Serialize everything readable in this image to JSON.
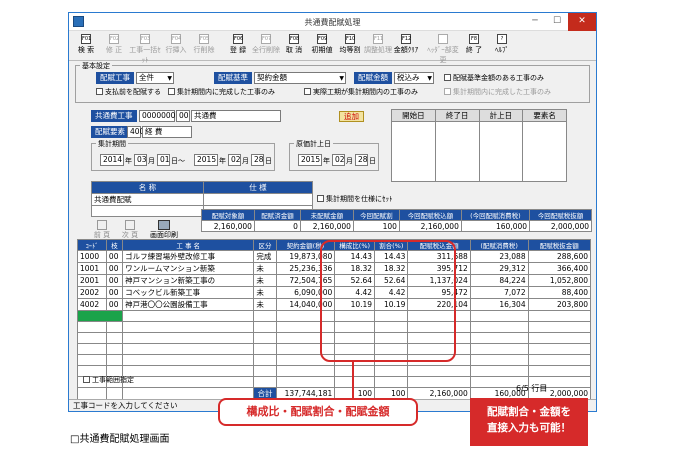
{
  "window": {
    "title": "共通費配賦処理"
  },
  "toolbar": [
    {
      "key": "F01",
      "label": "検 索",
      "enabled": true
    },
    {
      "key": "F02",
      "label": "修 正",
      "enabled": false
    },
    {
      "key": "F03",
      "label": "工事一括ｾｯﾄ",
      "enabled": false
    },
    {
      "key": "F04",
      "label": "行挿入",
      "enabled": false
    },
    {
      "key": "F05",
      "label": "行削除",
      "enabled": false
    },
    {
      "key": "F06",
      "label": "登 録",
      "enabled": true
    },
    {
      "key": "F07",
      "label": "全行削除",
      "enabled": false
    },
    {
      "key": "F08",
      "label": "取 消",
      "enabled": true
    },
    {
      "key": "F09",
      "label": "初期値",
      "enabled": true
    },
    {
      "key": "F10",
      "label": "均等割",
      "enabled": true
    },
    {
      "key": "F11",
      "label": "調整処理",
      "enabled": false
    },
    {
      "key": "F12",
      "label": "金額ｸﾘｱ",
      "enabled": true
    },
    {
      "key": "",
      "label": "ﾍｯﾀﾞｰ部変更",
      "enabled": false
    },
    {
      "key": "F8",
      "label": "終 了",
      "enabled": true
    },
    {
      "key": "?",
      "label": "ﾍﾙﾌﾟ",
      "enabled": true
    }
  ],
  "settings": {
    "group_label": "基本設定",
    "target_label": "配賦工事",
    "target_value": "全件",
    "basis_label": "配賦基準",
    "basis_value": "契約金額",
    "amount_label": "配賦金額",
    "amount_value": "税込み",
    "cb_basis_only": "配賦基準金額のある工事のみ",
    "cb_paid": "支払前を配賦する",
    "cb_period_completed": "集計期間内に完成した工事のみ",
    "cb_actual": "実際工期が集計期間内の工事のみ",
    "cb_completed_disabled": "集計期間内に完成した工事のみ"
  },
  "common": {
    "label": "共通費工事",
    "code": "0000000",
    "sub": "00",
    "name": "共通費",
    "add_label": "追加",
    "item_label": "配賦要素",
    "item_code": "400",
    "item_name": "経 費"
  },
  "side_table": {
    "headers": [
      "開始日",
      "終了日",
      "計上日",
      "要素名"
    ]
  },
  "period": {
    "group_label": "集計期間",
    "from_year": "2014",
    "from_month": "03",
    "from_day": "01",
    "tilde": "日～",
    "to_year": "2015",
    "to_month": "02",
    "to_day": "28",
    "post_group": "原価計上日",
    "post_year": "2015",
    "post_month": "02",
    "post_day": "28",
    "y": "年",
    "m": "月",
    "d": "日"
  },
  "name_grid": {
    "h1": "名 称",
    "h2": "仕 様",
    "row_name": "共通費配賦",
    "cb_label": "集計期間を仕様にｾｯﾄ"
  },
  "summary": {
    "headers": [
      "配賦対象額",
      "配賦済金額",
      "未配賦金額",
      "今回配賦割",
      "今回配賦税込額",
      "(今回配賦消費税)",
      "今回配賦税抜額"
    ],
    "values": [
      "2,160,000",
      "0",
      "2,160,000",
      "100",
      "2,160,000",
      "160,000",
      "2,000,000"
    ]
  },
  "nav": {
    "prev": "前 頁",
    "next": "次 頁",
    "print": "画面印刷"
  },
  "main_table": {
    "headers": [
      "ｺｰﾄﾞ",
      "枝",
      "工 事 名",
      "区分",
      "契約金額(税)",
      "構成比(%)",
      "割合(%)",
      "配賦税込金額",
      "(配賦消費税)",
      "配賦税抜金額"
    ],
    "rows": [
      [
        "1000",
        "00",
        "ゴルフ練習場外壁改修工事",
        "完成",
        "19,873,080",
        "14.43",
        "14.43",
        "311,688",
        "23,088",
        "288,600"
      ],
      [
        "1001",
        "00",
        "ワンルームマンション新築",
        "未",
        "25,236,336",
        "18.32",
        "18.32",
        "395,712",
        "29,312",
        "366,400"
      ],
      [
        "2001",
        "00",
        "神戸マンション新築工事の",
        "未",
        "72,504,765",
        "52.64",
        "52.64",
        "1,137,024",
        "84,224",
        "1,052,800"
      ],
      [
        "2002",
        "00",
        "コベックビル新築工事",
        "未",
        "6,090,000",
        "4.42",
        "4.42",
        "95,472",
        "7,072",
        "88,400"
      ],
      [
        "4002",
        "00",
        "神戸港〇〇公園設備工事",
        "未",
        "14,040,000",
        "10.19",
        "10.19",
        "220,104",
        "16,304",
        "203,800"
      ]
    ],
    "total_label": "合計",
    "total": [
      "137,744,181",
      "100",
      "100",
      "2,160,000",
      "160,000",
      "2,000,000"
    ]
  },
  "footer": {
    "range_cb": "工事範囲指定",
    "page_info": "6/5 行目",
    "status": "工事コードを入力してください"
  },
  "annotations": {
    "callout": "構成比・配賦割合・配賦金額",
    "note_line1": "配賦割合・金額を",
    "note_line2": "直接入力も可能！",
    "caption": "□共通費配賦処理画面"
  },
  "colors": {
    "accent": "#1e50a0",
    "highlight": "#d62a2a",
    "selection": "#1aa34a"
  }
}
